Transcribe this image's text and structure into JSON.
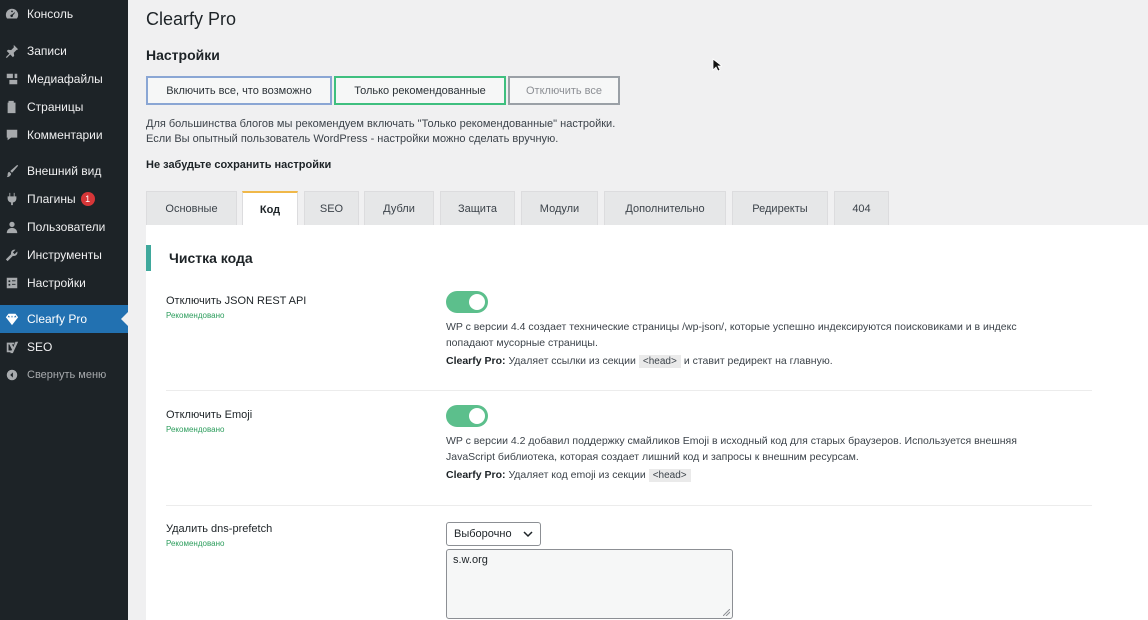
{
  "sidebar": {
    "items": [
      {
        "label": "Консоль",
        "icon": "dashboard-icon"
      },
      {
        "label": "Записи",
        "icon": "pin-icon"
      },
      {
        "label": "Медиафайлы",
        "icon": "media-icon"
      },
      {
        "label": "Страницы",
        "icon": "page-icon"
      },
      {
        "label": "Комментарии",
        "icon": "comment-icon"
      },
      {
        "label": "Внешний вид",
        "icon": "brush-icon"
      },
      {
        "label": "Плагины",
        "icon": "plugin-icon",
        "badge": "1"
      },
      {
        "label": "Пользователи",
        "icon": "user-icon"
      },
      {
        "label": "Инструменты",
        "icon": "wrench-icon"
      },
      {
        "label": "Настройки",
        "icon": "settings-icon"
      },
      {
        "label": "Clearfy Pro",
        "icon": "diamond-icon",
        "active": true
      },
      {
        "label": "SEO",
        "icon": "yoast-icon"
      }
    ],
    "collapse_label": "Свернуть меню"
  },
  "header": {
    "title": "Clearfy Pro",
    "section": "Настройки"
  },
  "presets": {
    "enable_all": "Включить все, что возможно",
    "recommended": "Только рекомендованные",
    "disable_all": "Отключить все"
  },
  "hint": {
    "line1": "Для большинства блогов мы рекомендуем включать \"Только рекомендованные\" настройки.",
    "line2": "Если Вы опытный пользователь WordPress - настройки можно сделать вручную."
  },
  "save_note": "Не забудьте сохранить настройки",
  "tabs": [
    "Основные",
    "Код",
    "SEO",
    "Дубли",
    "Защита",
    "Модули",
    "Дополнительно",
    "Редиректы",
    "404"
  ],
  "active_tab": "Код",
  "panel": {
    "heading": "Чистка кода",
    "recommended_label": "Рекомендовано",
    "options": [
      {
        "label": "Отключить JSON REST API",
        "enabled": true,
        "desc1": "WP с версии 4.4 создает технические страницы /wp-json/, которые успешно индексируются поисковиками и в индекс",
        "desc2": "попадают мусорные страницы.",
        "note_prefix": "Clearfy Pro:",
        "note_text": "Удаляет ссылки из секции",
        "note_code": "<head>",
        "note_suffix": "и ставит редирект на главную."
      },
      {
        "label": "Отключить Emoji",
        "enabled": true,
        "desc1": "WP с версии 4.2 добавил поддержку смайликов Emoji в исходный код для старых браузеров. Используется внешняя",
        "desc2": "JavaScript библиотека, которая создает лишний код и запросы к внешним ресурсам.",
        "note_prefix": "Clearfy Pro:",
        "note_text": "Удаляет код emoji из секции",
        "note_code": "<head>"
      },
      {
        "label": "Удалить dns-prefetch",
        "select_value": "Выборочно",
        "textarea_value": "s.w.org"
      }
    ]
  },
  "colors": {
    "sidebar_bg": "#1d2327",
    "active_menu": "#2271b1",
    "toggle_on": "#5cbf8c",
    "recommended_text": "#2e9e5e",
    "accent_heading": "#3fa89c"
  }
}
